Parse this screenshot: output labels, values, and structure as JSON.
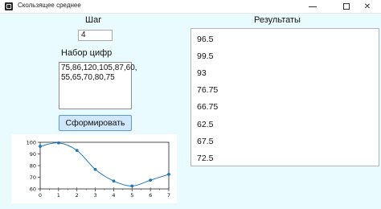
{
  "window": {
    "title": "Скользящее среднее",
    "controls": {
      "minimize": "—",
      "maximize": "☐",
      "close": "✕"
    }
  },
  "form": {
    "step_label": "Шаг",
    "step_value": "4",
    "digits_label": "Набор цифр",
    "digits_lines": [
      "75,86,120,105,87,60,",
      "55,65,70,80,75"
    ],
    "submit_label": "Сформировать"
  },
  "results": {
    "label": "Результаты",
    "items": [
      "96.5",
      "99.5",
      "93",
      "76.75",
      "66.75",
      "62.5",
      "67.5",
      "72.5"
    ]
  },
  "chart_data": {
    "type": "line",
    "x": [
      0,
      1,
      2,
      3,
      4,
      5,
      6,
      7
    ],
    "y": [
      96.5,
      99.5,
      93,
      76.75,
      66.75,
      62.5,
      67.5,
      72.5
    ],
    "xlim": [
      0,
      7
    ],
    "ylim": [
      60,
      100
    ],
    "xticks": [
      "0",
      "1",
      "2",
      "3",
      "4",
      "5",
      "6",
      "7"
    ],
    "yticks": [
      "60",
      "70",
      "80",
      "90",
      "100"
    ],
    "line_color": "#1f77b4",
    "grid": false
  }
}
